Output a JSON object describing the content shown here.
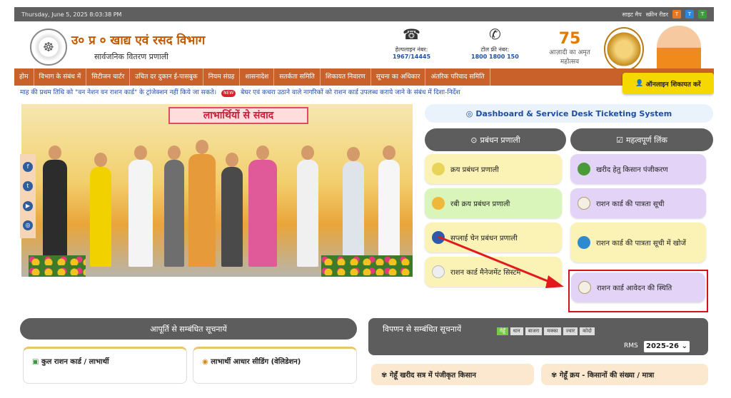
{
  "topbar": {
    "datetime": "Thursday, June 5, 2025 8:03:38 PM",
    "sitemap": "साइट मैप",
    "reader": "स्क्रीन रीडर"
  },
  "header": {
    "title": "उ० प्र ० खाद्य एवं रसद विभाग",
    "subtitle": "सार्वजनिक वितरण प्रणाली",
    "helpline_label": "हेल्पलाइन नंबर:",
    "helpline_number": "1967/14445",
    "tollfree_label": "टोल फ्री नंबर:",
    "tollfree_number": "1800 1800 150",
    "azadi_text": "आज़ादी का अमृत महोत्सव",
    "azadi_num": "75"
  },
  "nav": [
    "होम",
    "विभाग के संबंध में",
    "सिटीजन चार्टर",
    "उचित दर दुकान ई-पासबुक",
    "नियम संग्रह",
    "शासनादेश",
    "सतर्कता समिति",
    "शिकायत निवारण",
    "सूचना का अधिकार",
    "अंतरिक परिवाद समिति"
  ],
  "complaint_button": "ऑनलाइन शिकायत करें",
  "ticker": {
    "left": "माह की प्रथम तिथि को \"वन नेशन वन राशन कार्ड\" के ट्रांजेक्शन नहीं किये जा सकते।",
    "badge": "NEW",
    "right": "बेघर एवं कचरा उठाने वाले नागरिकों को राशन कार्ड उपलब्ध कराये जाने के संबंध में दिशा-निर्देश"
  },
  "photo_banner": "लाभार्थियों से संवाद",
  "dashboard_link": "Dashboard & Service Desk Ticketing System",
  "management": {
    "title": "प्रबंधन प्रणाली",
    "items": [
      "क्रय प्रबंधन प्रणाली",
      "रबी क्रय प्रबंधन प्रणाली",
      "सप्लाई चेन प्रबंधन प्रणाली",
      "राशन कार्ड मैनेजमेंट सिस्टम"
    ]
  },
  "links": {
    "title": "महत्वपूर्ण लिंक",
    "items": [
      "खरीद हेतु किसान पंजीकरण",
      "राशन कार्ड की पात्रता सूची",
      "राशन कार्ड की पात्रता सूची में खोजें",
      "राशन कार्ड आवेदन की स्थिति"
    ]
  },
  "supply_section": {
    "title": "आपूर्ति से सम्बंधित सूचनायें",
    "cards": [
      "कुल राशन कार्ड / लाभार्थी",
      "लाभार्थी आधार सीडिंग (वेलिडेशन)"
    ]
  },
  "marketing_section": {
    "title": "विपणन से सम्बंधित सूचनायें",
    "crops": [
      "गेहूँ",
      "धान",
      "बाजरा",
      "मक्का",
      "ज्वार",
      "कोदो"
    ],
    "rms_label": "RMS",
    "rms_value": "2025-26",
    "cards": [
      "गेहूँ खरीद सत्र में पंजीकृत किसान",
      "गेहूँ क्रय - किसानों की संख्या / मात्रा"
    ]
  },
  "colors": {
    "nav": "#c8622a",
    "highlight_box": "#d3131a",
    "arrow": "#e11b1b"
  }
}
